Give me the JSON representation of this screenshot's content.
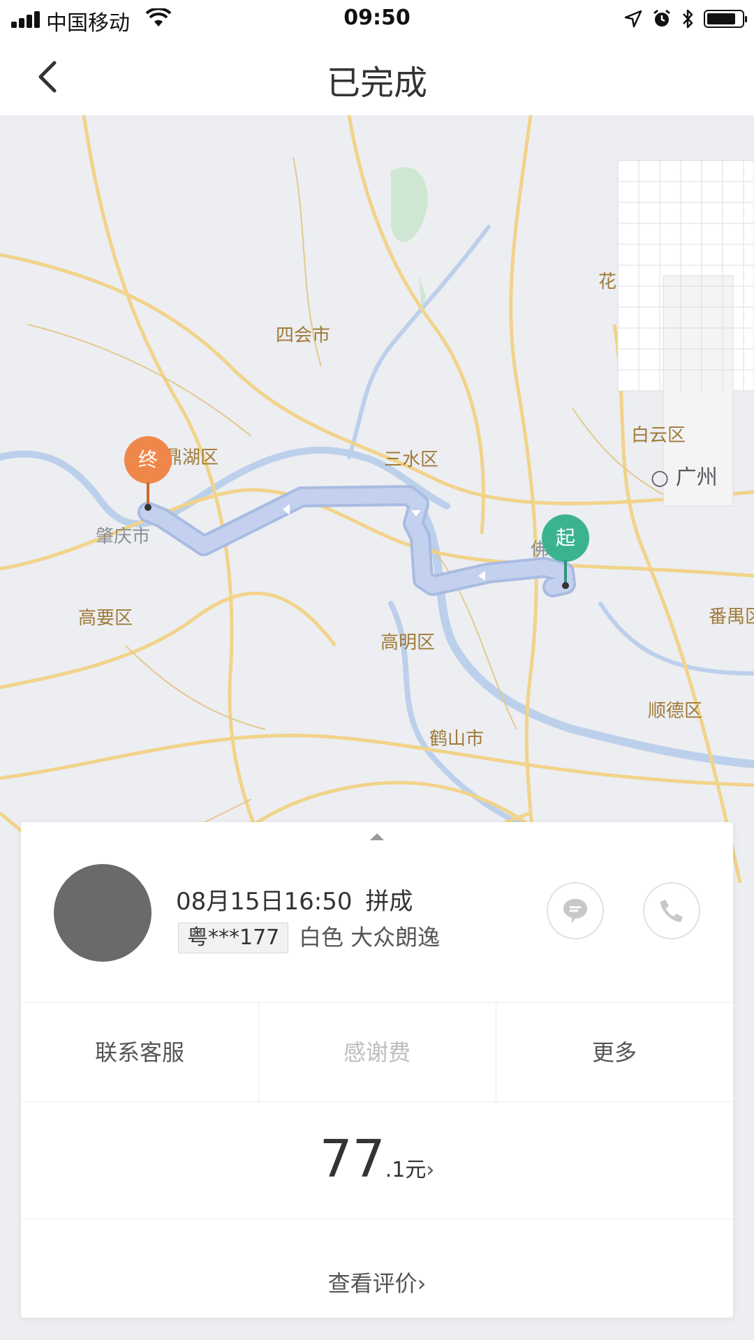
{
  "status_bar": {
    "carrier": "中国移动",
    "time": "09:50"
  },
  "nav": {
    "title": "已完成"
  },
  "map": {
    "labels": {
      "sihui": "四会市",
      "dinghu": "鼎湖区",
      "zhaoqing": "肇庆市",
      "gaoyao": "高要区",
      "sanshui": "三水区",
      "baiyun": "白云区",
      "guangzhou": "广州",
      "foshan": "佛山市",
      "gaoming": "高明区",
      "heshan": "鹤山市",
      "shunde": "顺德区",
      "panyu": "番禺区",
      "hua": "花"
    },
    "pins": {
      "start": "起",
      "end": "终"
    }
  },
  "trip": {
    "datetime": "08月15日16:50",
    "status": "拼成",
    "plate": "粤***177",
    "car": "白色 大众朗逸"
  },
  "actions": {
    "service": "联系客服",
    "tip": "感谢费",
    "more": "更多"
  },
  "fare": {
    "integer": "77",
    "decimal": ".1元",
    "arrow": "›"
  },
  "review": {
    "label": "查看评价",
    "arrow": "›"
  },
  "colors": {
    "start_pin": "#3bb391",
    "end_pin": "#f0874a",
    "route": "#bfcdea"
  }
}
